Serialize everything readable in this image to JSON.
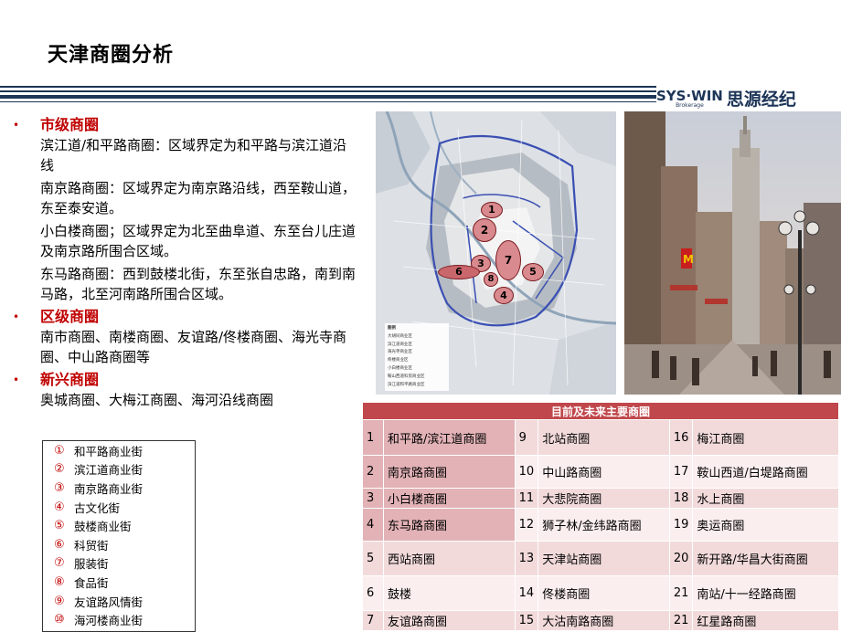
{
  "title": "天津商圈分析",
  "brand": {
    "en": "SYS·WIN",
    "en_sub": "Brokerage",
    "cn": "思源经纪"
  },
  "sections": [
    {
      "heading": "市级商圈",
      "paras": [
        "滨江道/和平路商圈：区域界定为和平路与滨江道沿线",
        "南京路商圈：区域界定为南京路沿线，西至鞍山道，东至泰安道。",
        "小白楼商圈；区域界定为北至曲阜道、东至台儿庄道及南京路所围合区域。",
        "东马路商圈：西到鼓楼北街，东至张自忠路，南到南马路，北至河南路所围合区域。"
      ]
    },
    {
      "heading": "区级商圈",
      "paras": [
        "南市商圈、南楼商圈、友谊路/佟楼商圈、海光寺商圈、中山路商圈等"
      ]
    },
    {
      "heading": "新兴商圈",
      "paras": [
        "奥城商圈、大梅江商圈、海河沿线商圈"
      ]
    }
  ],
  "legend": [
    {
      "num": "①",
      "label": "和平路商业街"
    },
    {
      "num": "②",
      "label": "滨江道商业街"
    },
    {
      "num": "③",
      "label": "南京路商业街"
    },
    {
      "num": "④",
      "label": "古文化街"
    },
    {
      "num": "⑤",
      "label": "鼓楼商业街"
    },
    {
      "num": "⑥",
      "label": "科贸街"
    },
    {
      "num": "⑦",
      "label": "服装街"
    },
    {
      "num": "⑧",
      "label": "食品街"
    },
    {
      "num": "⑨",
      "label": "友谊路风情街"
    },
    {
      "num": "⑩",
      "label": "海河楼商业街"
    }
  ],
  "map": {
    "markers": [
      "1",
      "2",
      "3",
      "4",
      "5",
      "6",
      "7",
      "8"
    ],
    "legend_title": "图例",
    "legend_items": [
      "大胡同商业区",
      "滨江道商业区",
      "海光寺商业区",
      "佟楼商业区",
      "小白楼商业区",
      "鞍山西道科贸商业区",
      "滨江道和平路商业区"
    ]
  },
  "table": {
    "title": "目前及未来主要商圈",
    "rows": [
      [
        [
          "1",
          "和平路/滨江道商圈"
        ],
        [
          "9",
          "北站商圈"
        ],
        [
          "16",
          "梅江商圈"
        ]
      ],
      [
        [
          "2",
          "南京路商圈"
        ],
        [
          "10",
          "中山路商圈"
        ],
        [
          "17",
          "鞍山西道/白堤路商圈"
        ]
      ],
      [
        [
          "3",
          "小白楼商圈"
        ],
        [
          "11",
          "大悲院商圈"
        ],
        [
          "18",
          "水上商圈"
        ]
      ],
      [
        [
          "4",
          "东马路商圈"
        ],
        [
          "12",
          "狮子林/金纬路商圈"
        ],
        [
          "19",
          "奥运商圈"
        ]
      ],
      [
        [
          "5",
          "西站商圈"
        ],
        [
          "13",
          "天津站商圈"
        ],
        [
          "20",
          "新开路/华昌大街商圈"
        ]
      ],
      [
        [
          "6",
          "鼓楼"
        ],
        [
          "14",
          "佟楼商圈"
        ],
        [
          "21",
          "南站/十一经路商圈"
        ]
      ],
      [
        [
          "7",
          "友谊路商圈"
        ],
        [
          "15",
          "大沽南路商圈"
        ],
        [
          "21",
          "红星路商圈"
        ]
      ]
    ]
  }
}
